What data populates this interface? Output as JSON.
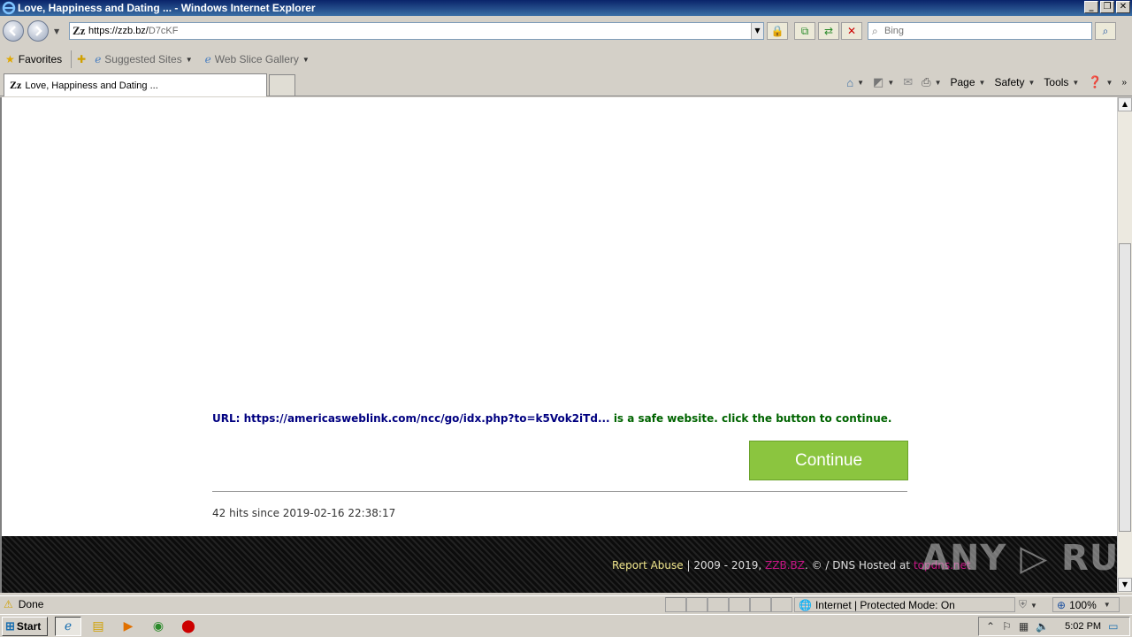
{
  "window": {
    "title": "Love, Happiness and Dating ... - Windows Internet Explorer",
    "min": "_",
    "restore": "❐",
    "close": "✕"
  },
  "address": {
    "url_host": "https://zzb.bz/",
    "url_path": "D7cKF",
    "site_icon": "Zz"
  },
  "search": {
    "placeholder": "Bing"
  },
  "favorites": {
    "favorites_label": "Favorites",
    "suggested_sites": "Suggested Sites",
    "web_slice_gallery": "Web Slice Gallery"
  },
  "tab": {
    "title": "Love, Happiness and Dating ..."
  },
  "commandbar": {
    "page": "Page",
    "safety": "Safety",
    "tools": "Tools"
  },
  "content": {
    "url_label": "URL:",
    "target_url": "https://americasweblink.com/ncc/go/idx.php?to=k5Vok2iTd...",
    "safe_text": "is a safe website. click the button to continue.",
    "continue_label": "Continue",
    "hits_text": "42 hits since 2019-02-16 22:38:17"
  },
  "footer": {
    "report_abuse": "Report Abuse",
    "years": " | 2009 - 2019, ",
    "brand": "ZZB.BZ",
    "rest": ". © / DNS Hosted at ",
    "host_link": "topdns.net"
  },
  "watermark": "ANY ▷ RUN",
  "status": {
    "text": "Done",
    "zone": "Internet | Protected Mode: On",
    "zoom": "100%"
  },
  "taskbar": {
    "start": "Start",
    "clock": "5:02 PM"
  }
}
